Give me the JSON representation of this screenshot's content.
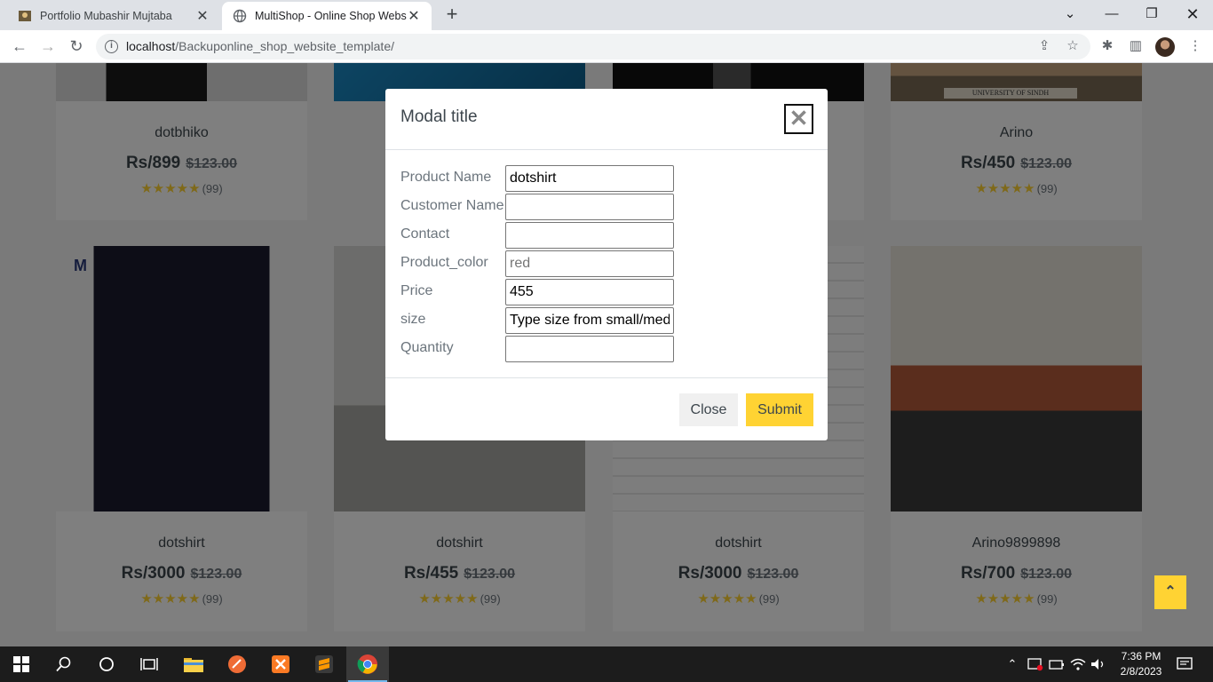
{
  "browser": {
    "tabs": [
      {
        "title": "Portfolio Mubashir Mujtaba"
      },
      {
        "title": "MultiShop - Online Shop Website"
      }
    ],
    "url_host": "localhost",
    "url_path": "/Backuponline_shop_website_template/"
  },
  "products_top": [
    {
      "name": "dotbhiko",
      "price": "Rs/899",
      "old_price": "$123.00",
      "reviews": "(99)"
    },
    {
      "name": "Arino",
      "price": "Rs/450",
      "old_price": "$123.00",
      "reviews": "(99)"
    }
  ],
  "products_bottom": [
    {
      "name": "dotshirt",
      "price": "Rs/3000",
      "old_price": "$123.00",
      "reviews": "(99)"
    },
    {
      "name": "dotshirt",
      "price": "Rs/455",
      "old_price": "$123.00",
      "reviews": "(99)"
    },
    {
      "name": "dotshirt",
      "price": "Rs/3000",
      "old_price": "$123.00",
      "reviews": "(99)"
    },
    {
      "name": "Arino9899898",
      "price": "Rs/700",
      "old_price": "$123.00",
      "reviews": "(99)"
    }
  ],
  "stars": "★★★★★",
  "image_text": {
    "sign": "UNIVERSITY OF SINDH",
    "logo": "M"
  },
  "modal": {
    "title": "Modal title",
    "fields": [
      {
        "label": "Product Name",
        "value": "dotshirt",
        "placeholder": ""
      },
      {
        "label": "Customer Name",
        "value": "",
        "placeholder": ""
      },
      {
        "label": "Contact",
        "value": "",
        "placeholder": ""
      },
      {
        "label": "Product_color",
        "value": "",
        "placeholder": "red"
      },
      {
        "label": "Price",
        "value": "455",
        "placeholder": ""
      },
      {
        "label": "size",
        "value": "Type size from small/medium/large",
        "placeholder": ""
      },
      {
        "label": "Quantity",
        "value": "",
        "placeholder": ""
      }
    ],
    "close_label": "Close",
    "submit_label": "Submit"
  },
  "taskbar": {
    "time": "7:36 PM",
    "date": "2/8/2023"
  },
  "colors": {
    "accent": "#ffd333",
    "text": "#3d464d",
    "muted": "#6c757d"
  }
}
